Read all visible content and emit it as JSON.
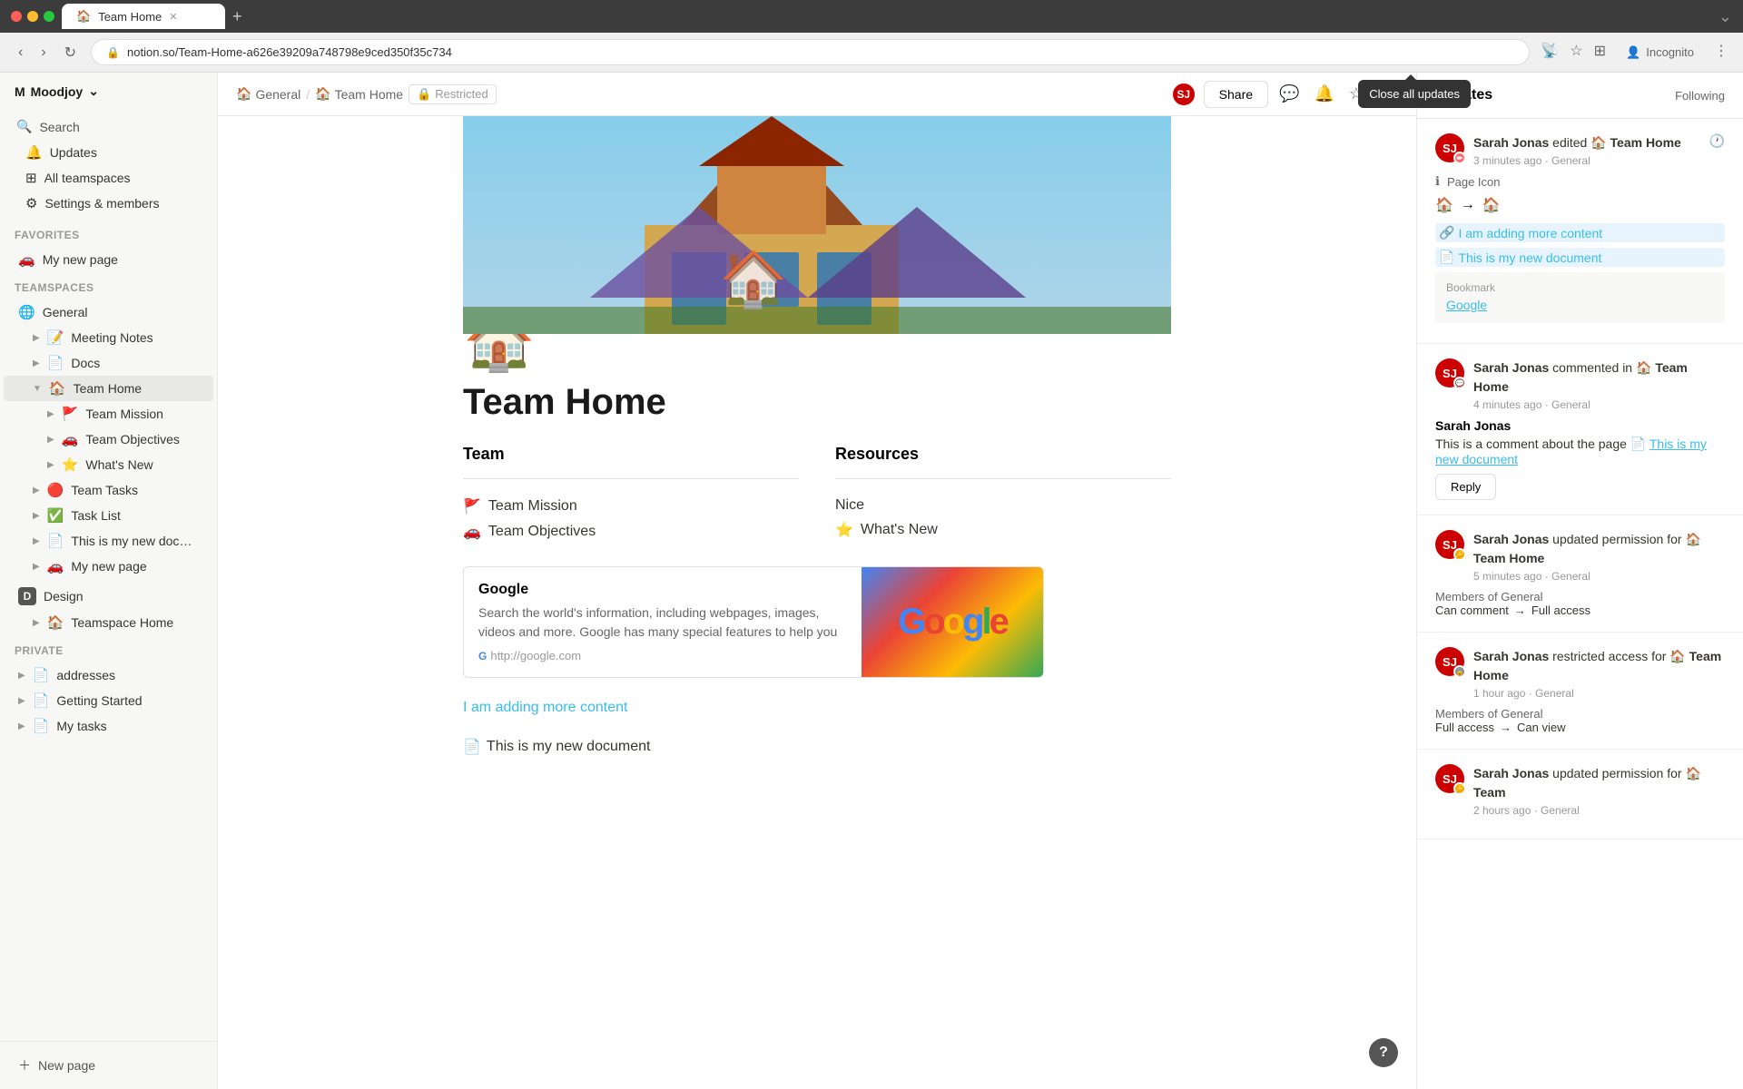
{
  "browser": {
    "tab_title": "Team Home",
    "tab_favicon": "🏠",
    "address": "notion.so/Team-Home-a626e39209a748798e9ced350f35c734",
    "new_tab_btn": "+",
    "incognito_label": "Incognito"
  },
  "topbar": {
    "breadcrumb_home": "General",
    "breadcrumb_page": "Team Home",
    "restricted_label": "Restricted",
    "share_btn": "Share",
    "close_updates_tooltip": "Close all updates"
  },
  "sidebar": {
    "workspace_name": "Moodjoy",
    "search_label": "Search",
    "updates_label": "Updates",
    "all_teamspaces_label": "All teamspaces",
    "settings_label": "Settings & members",
    "favorites_section": "Favorites",
    "favorites_items": [
      {
        "icon": "🚗",
        "label": "My new page"
      }
    ],
    "teamspaces_section": "Teamspaces",
    "teamspace_items": [
      {
        "icon": "🌐",
        "label": "General",
        "expanded": true
      },
      {
        "icon": "📝",
        "label": "Meeting Notes",
        "indent": 1
      },
      {
        "icon": "📄",
        "label": "Docs",
        "indent": 1
      },
      {
        "icon": "🏠",
        "label": "Team Home",
        "indent": 1,
        "active": true
      },
      {
        "icon": "🚩",
        "label": "Team Mission",
        "indent": 2
      },
      {
        "icon": "🚗",
        "label": "Team Objectives",
        "indent": 2
      },
      {
        "icon": "⭐",
        "label": "What's New",
        "indent": 2
      },
      {
        "icon": "🔴",
        "label": "Team Tasks",
        "indent": 1
      },
      {
        "icon": "✅",
        "label": "Task List",
        "indent": 1
      },
      {
        "icon": "📄",
        "label": "This is my new document",
        "indent": 1
      },
      {
        "icon": "🚗",
        "label": "My new page",
        "indent": 1
      }
    ],
    "design_section": "D",
    "design_label": "Design",
    "teamspace_home_icon": "🏠",
    "teamspace_home_label": "Teamspace Home",
    "private_section": "Private",
    "private_items": [
      {
        "icon": "📄",
        "label": "addresses"
      },
      {
        "icon": "📄",
        "label": "Getting Started"
      },
      {
        "icon": "📄",
        "label": "My tasks"
      }
    ],
    "new_page_label": "New page"
  },
  "page": {
    "title": "Team Home",
    "icon": "🏠",
    "team_section_header": "Team",
    "resources_section_header": "Resources",
    "team_items": [
      {
        "icon": "🚩",
        "label": "Team Mission"
      },
      {
        "icon": "🚗",
        "label": "Team Objectives"
      }
    ],
    "resources_items": [
      {
        "icon": "",
        "label": "Nice"
      },
      {
        "icon": "⭐",
        "label": "What's New"
      }
    ],
    "bookmark_title": "Google",
    "bookmark_desc": "Search the world's information, including webpages, images, videos and more. Google has many special features to help you",
    "bookmark_url": "http://google.com",
    "adding_content_link": "I am adding more content",
    "new_document_link": "This is my new document"
  },
  "updates": {
    "title": "Updates",
    "following_btn": "Following",
    "items": [
      {
        "id": 1,
        "author": "Sarah Jonas",
        "avatar_initials": "SJ",
        "action": "edited",
        "page_icon": "🏠",
        "page_name": "Team Home",
        "time": "3 minutes ago",
        "workspace": "General",
        "detail_type": "page_icon_change",
        "icon_from": "🏠",
        "icon_to": "🏠",
        "content_link": "I am adding more content",
        "doc_link": "This is my new document",
        "bookmark_label": "Bookmark",
        "bookmark_link": "Google"
      },
      {
        "id": 2,
        "author": "Sarah Jonas",
        "avatar_initials": "SJ",
        "action": "commented in",
        "page_icon": "🏠",
        "page_name": "Team Home",
        "time": "4 minutes ago",
        "workspace": "General",
        "comment_author": "Sarah Jonas",
        "comment_text": "This is a comment about the page",
        "comment_doc": "This is my new document",
        "reply_btn": "Reply"
      },
      {
        "id": 3,
        "author": "Sarah Jonas",
        "avatar_initials": "SJ",
        "action": "updated permission for",
        "page_icon": "🏠",
        "page_name": "Team Home",
        "time": "5 minutes ago",
        "workspace": "General",
        "perm_subject": "Members of General",
        "perm_from": "Can comment",
        "perm_to": "Full access"
      },
      {
        "id": 4,
        "author": "Sarah Jonas",
        "avatar_initials": "SJ",
        "action": "restricted access for",
        "page_icon": "🏠",
        "page_name": "Team Home",
        "time": "1 hour ago",
        "workspace": "General",
        "perm_subject": "Members of General",
        "perm_from": "Full access",
        "perm_to": "Can view"
      },
      {
        "id": 5,
        "author": "Sarah Jonas",
        "avatar_initials": "SJ",
        "action": "updated permission for",
        "page_icon": "🏠",
        "page_name": "Team",
        "time": "2 hours ago",
        "workspace": "General"
      }
    ]
  }
}
